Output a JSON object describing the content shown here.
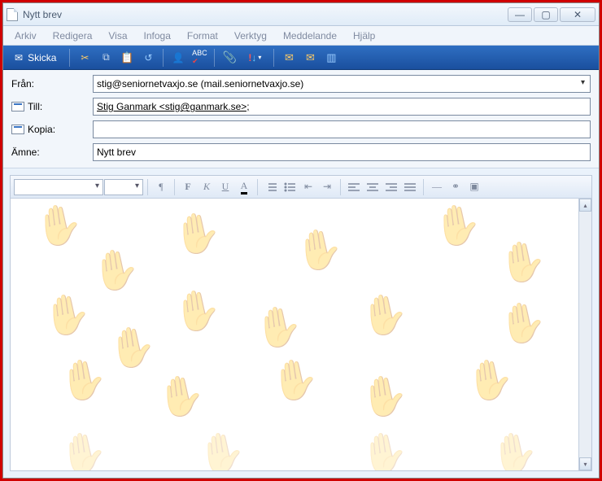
{
  "window": {
    "title": "Nytt brev"
  },
  "menu": {
    "arkiv": "Arkiv",
    "redigera": "Redigera",
    "visa": "Visa",
    "infoga": "Infoga",
    "format": "Format",
    "verktyg": "Verktyg",
    "meddelande": "Meddelande",
    "hjalp": "Hjälp"
  },
  "toolbar": {
    "send": "Skicka"
  },
  "icons": {
    "send": "✉",
    "cut": "✂",
    "copy": "⧉",
    "paste": "📋",
    "undo": "↺",
    "check": "✔",
    "spell": "ᴬᴮ",
    "attach": "📎",
    "priority": "!",
    "sign": "✉",
    "encrypt": "✉",
    "offline": "⇄"
  },
  "fields": {
    "from_label": "Från:",
    "from_value": "stig@seniornetvaxjo.se    (mail.seniornetvaxjo.se)",
    "to_label": "Till:",
    "to_value": "Stig Ganmark <stig@ganmark.se>;",
    "cc_label": "Kopia:",
    "cc_value": "",
    "subject_label": "Ämne:",
    "subject_value": "Nytt brev"
  },
  "editor": {
    "para": "¶",
    "bold": "F",
    "italic": "K",
    "underline": "U",
    "fontcolor": "A",
    "numlist": "≡",
    "bullist": "≡",
    "outdent": "⇤",
    "indent": "⇥",
    "alignL": "≡",
    "alignC": "≡",
    "alignR": "≡",
    "alignJ": "≡",
    "hr": "—",
    "link": "⚭",
    "image": "▣"
  }
}
